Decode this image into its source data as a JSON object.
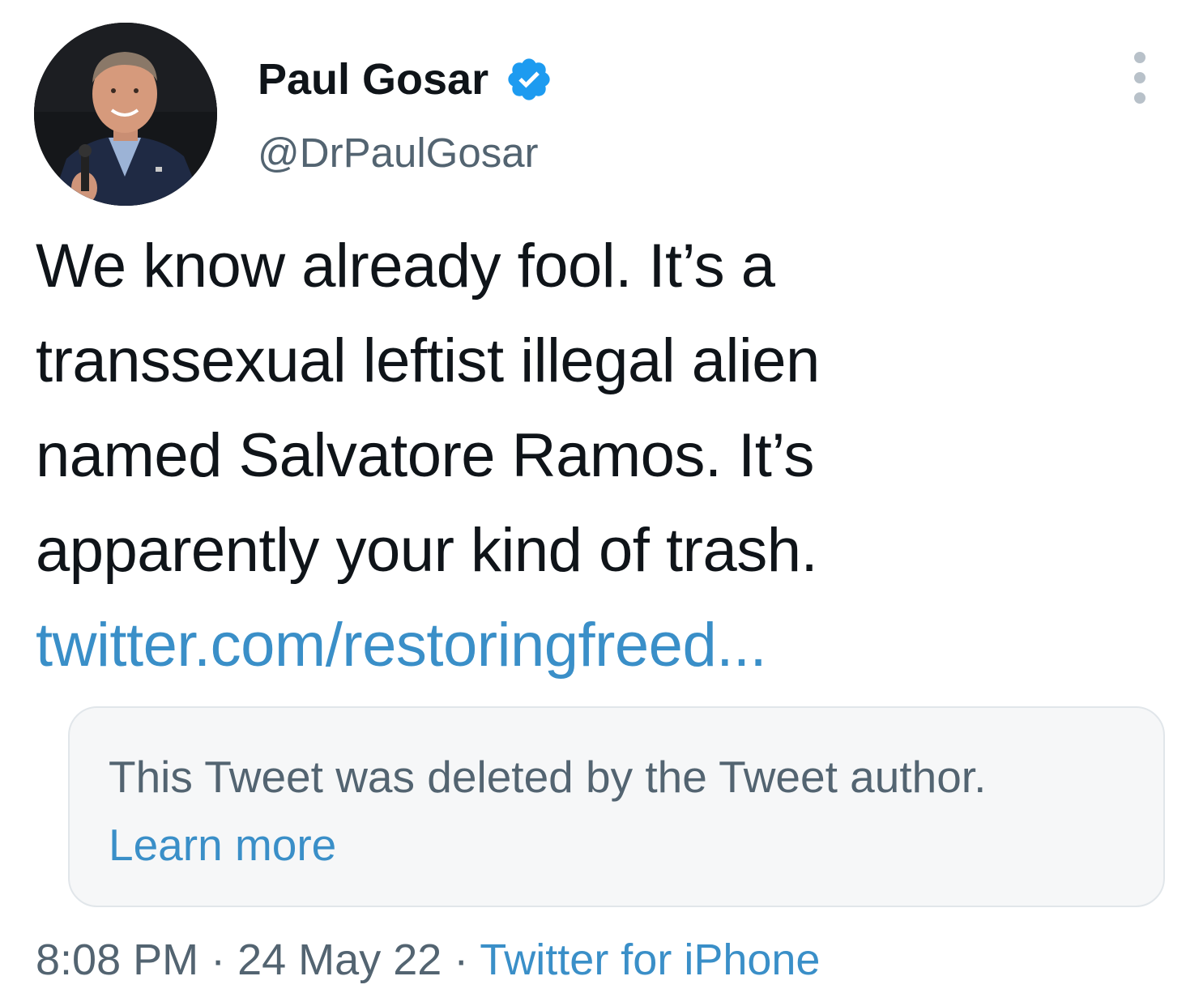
{
  "author": {
    "display_name": "Paul Gosar",
    "handle": "@DrPaulGosar",
    "verified": true
  },
  "tweet": {
    "text_lines": [
      "We know already fool.  It’s a",
      "transsexual leftist illegal alien",
      "named Salvatore Ramos.  It’s",
      "apparently your kind of trash."
    ],
    "link_text": "twitter.com/restoringfreed..."
  },
  "quoted_tweet": {
    "message": "This Tweet was deleted by the Tweet author.",
    "learn_more": "Learn more"
  },
  "meta": {
    "time": "8:08 PM",
    "separator": " · ",
    "date": "24 May 22",
    "source": "Twitter for iPhone"
  },
  "colors": {
    "verified_badge": "#1d9bf0",
    "link": "#3a8fc8",
    "secondary_text": "#536471",
    "card_background": "#f6f7f8"
  },
  "icons": {
    "verified": "verified-badge-icon",
    "more": "more-options-icon"
  }
}
